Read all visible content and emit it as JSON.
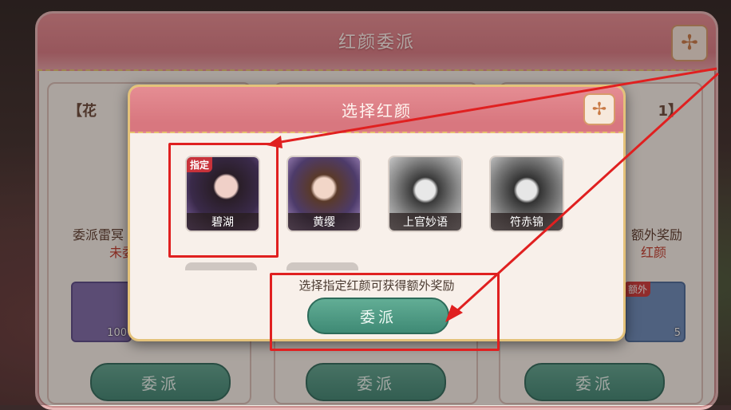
{
  "window": {
    "title": "红颜委派"
  },
  "modal": {
    "title": "选择红颜",
    "hint": "选择指定红颜可获得额外奖励",
    "dispatch_label": "委派",
    "designated_tag": "指定",
    "portraits": [
      {
        "name": "碧湖",
        "designated": true,
        "selected": true,
        "colors": [
          "#3a2a4a",
          "#8a6ab0"
        ]
      },
      {
        "name": "黄缨",
        "designated": false,
        "selected": false,
        "colors": [
          "#3d2b4a",
          "#9a7ac0"
        ]
      },
      {
        "name": "上官妙语",
        "designated": false,
        "selected": false,
        "colors": [
          "#6a6a6a",
          "#cfcfcf"
        ]
      },
      {
        "name": "符赤锦",
        "designated": false,
        "selected": false,
        "colors": [
          "#5a5a5a",
          "#c8c8c8"
        ]
      }
    ]
  },
  "background_cards": [
    {
      "title": "【花",
      "line1": "委派雷冥",
      "line2": "未委",
      "reward_qty": "100",
      "reward_badge": "",
      "dispatch_label": "委派"
    },
    {
      "title": "",
      "line1": "",
      "line2": "",
      "reward_qty": "",
      "reward_badge": "",
      "dispatch_label": "委派"
    },
    {
      "title": "1】",
      "line1": "额外奖励",
      "line2": "红颜",
      "reward_qty": "5",
      "reward_badge": "额外",
      "dispatch_label": "委派"
    }
  ],
  "colors": {
    "header_pink": "#d8777f",
    "gold_border": "#e4c27a",
    "button_green": "#3f8a75",
    "highlight_red": "#e02020"
  }
}
